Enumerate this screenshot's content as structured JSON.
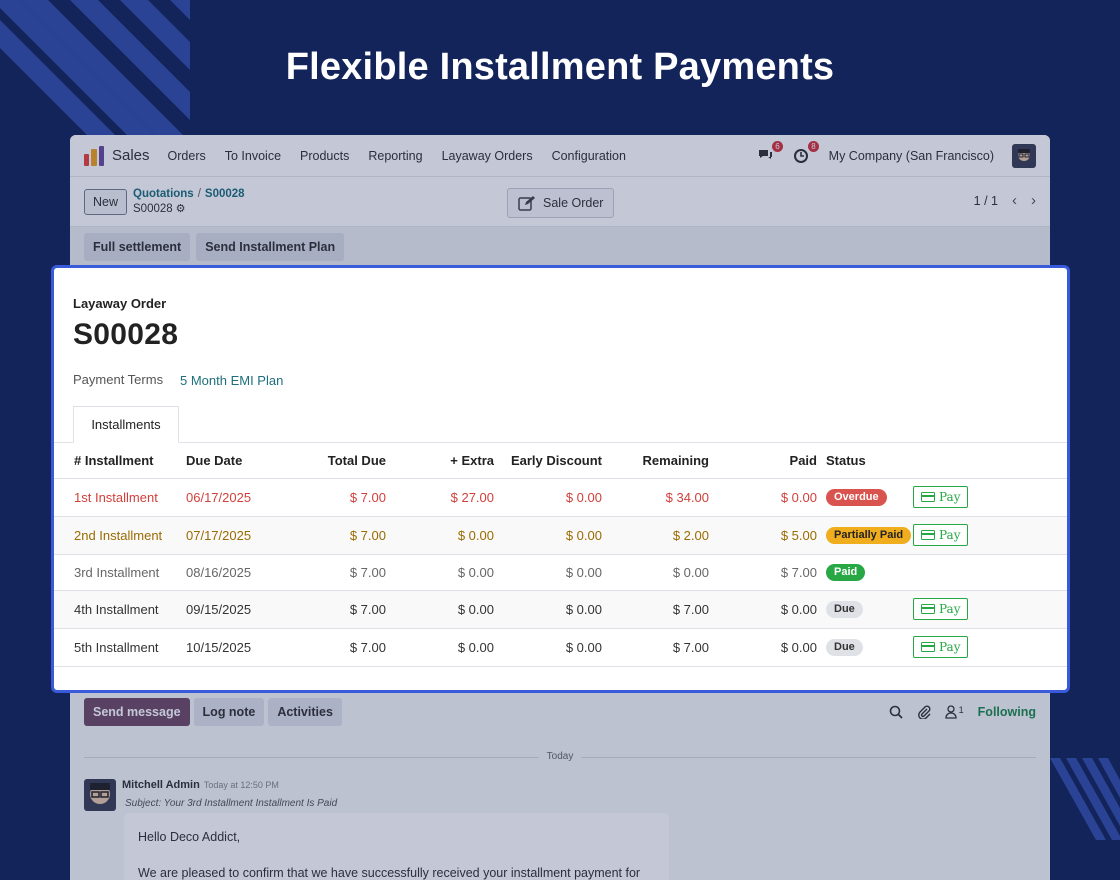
{
  "hero": {
    "title": "Flexible Installment Payments"
  },
  "colors": {
    "background": "#13245a",
    "highlight_border": "#3a5bd9",
    "accent_link": "#1e6f7d",
    "overdue": "#d9534f",
    "partial": "#f0ad1e",
    "paid": "#28a745"
  },
  "navbar": {
    "app_name": "Sales",
    "menu": [
      "Orders",
      "To Invoice",
      "Products",
      "Reporting",
      "Layaway Orders",
      "Configuration"
    ],
    "messages_badge": "6",
    "activities_badge": "8",
    "company": "My Company (San Francisco)"
  },
  "control": {
    "new_label": "New",
    "breadcrumb_parent": "Quotations",
    "breadcrumb_sep": "/",
    "breadcrumb_current": "S00028",
    "record_name": "S00028",
    "smart_button": "Sale Order",
    "pager": "1 / 1"
  },
  "actions": {
    "full_settlement": "Full settlement",
    "send_plan": "Send Installment Plan"
  },
  "form": {
    "label": "Layaway Order",
    "title": "S00028",
    "payment_terms_label": "Payment Terms",
    "payment_terms_value": "5 Month EMI Plan",
    "tab": "Installments"
  },
  "table": {
    "headers": [
      "# Installment",
      "Due Date",
      "Total Due",
      "+ Extra",
      "Early Discount",
      "Remaining",
      "Paid",
      "Status"
    ],
    "pay_label": "Pay",
    "rows": [
      {
        "name": "1st Installment",
        "due_date": "06/17/2025",
        "total_due": "$ 7.00",
        "extra": "$ 27.00",
        "discount": "$ 0.00",
        "remaining": "$ 34.00",
        "paid": "$ 0.00",
        "status": "Overdue",
        "show_pay": true
      },
      {
        "name": "2nd Installment",
        "due_date": "07/17/2025",
        "total_due": "$ 7.00",
        "extra": "$ 0.00",
        "discount": "$ 0.00",
        "remaining": "$ 2.00",
        "paid": "$ 5.00",
        "status": "Partially Paid",
        "show_pay": true
      },
      {
        "name": "3rd Installment",
        "due_date": "08/16/2025",
        "total_due": "$ 7.00",
        "extra": "$ 0.00",
        "discount": "$ 0.00",
        "remaining": "$ 0.00",
        "paid": "$ 7.00",
        "status": "Paid",
        "show_pay": false
      },
      {
        "name": "4th Installment",
        "due_date": "09/15/2025",
        "total_due": "$ 7.00",
        "extra": "$ 0.00",
        "discount": "$ 0.00",
        "remaining": "$ 7.00",
        "paid": "$ 0.00",
        "status": "Due",
        "show_pay": true
      },
      {
        "name": "5th Installment",
        "due_date": "10/15/2025",
        "total_due": "$ 7.00",
        "extra": "$ 0.00",
        "discount": "$ 0.00",
        "remaining": "$ 7.00",
        "paid": "$ 0.00",
        "status": "Due",
        "show_pay": true
      }
    ]
  },
  "chatter": {
    "send_message": "Send message",
    "log_note": "Log note",
    "activities": "Activities",
    "followers_count": "1",
    "following": "Following",
    "today": "Today",
    "author": "Mitchell Admin",
    "time": "Today at 12:50 PM",
    "subject": "Subject: Your 3rd Installment Installment Is Paid",
    "greeting": "Hello Deco Addict,",
    "body": "We are pleased to confirm that we have successfully received your installment payment for"
  }
}
